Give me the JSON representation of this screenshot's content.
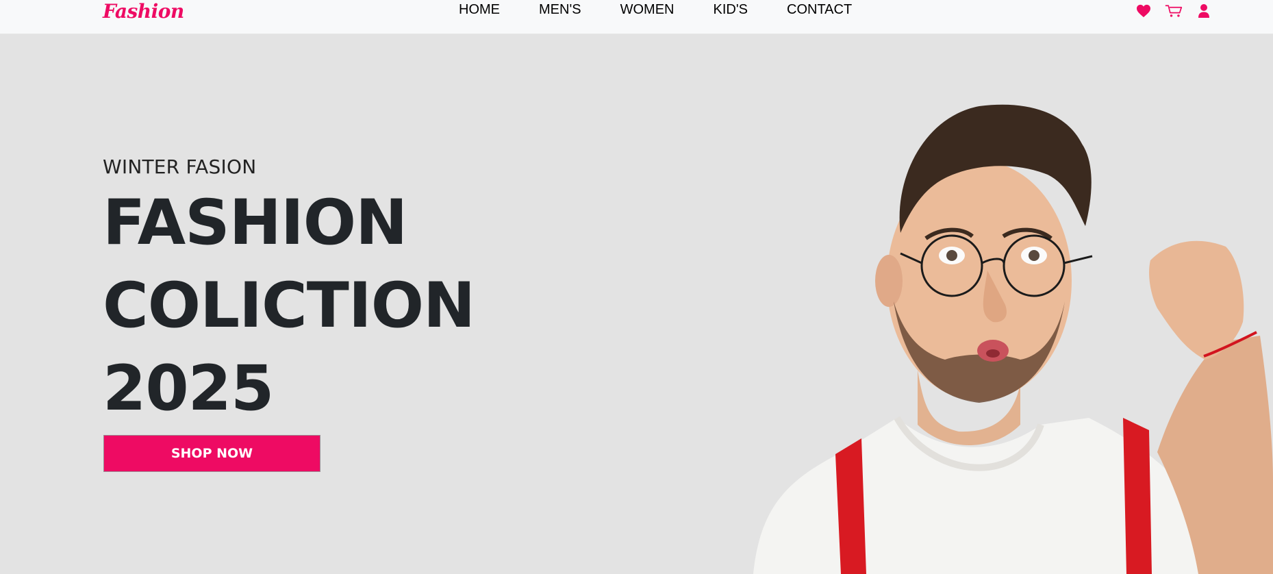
{
  "brand": {
    "name": "Fashion",
    "color": "#ee0b63"
  },
  "nav": {
    "links": [
      "HOME",
      "MEN'S",
      "WOMEN",
      "KID'S",
      "CONTACT"
    ],
    "icons": [
      "heart-icon",
      "cart-icon",
      "user-icon"
    ]
  },
  "hero": {
    "subtitle": "WINTER FASION",
    "headline_line1": "FASHION",
    "headline_line2": "COLICTION",
    "headline_line3": "2025",
    "cta_label": "SHOP NOW",
    "cta_color": "#ee0b63",
    "background": "#e3e3e3"
  }
}
